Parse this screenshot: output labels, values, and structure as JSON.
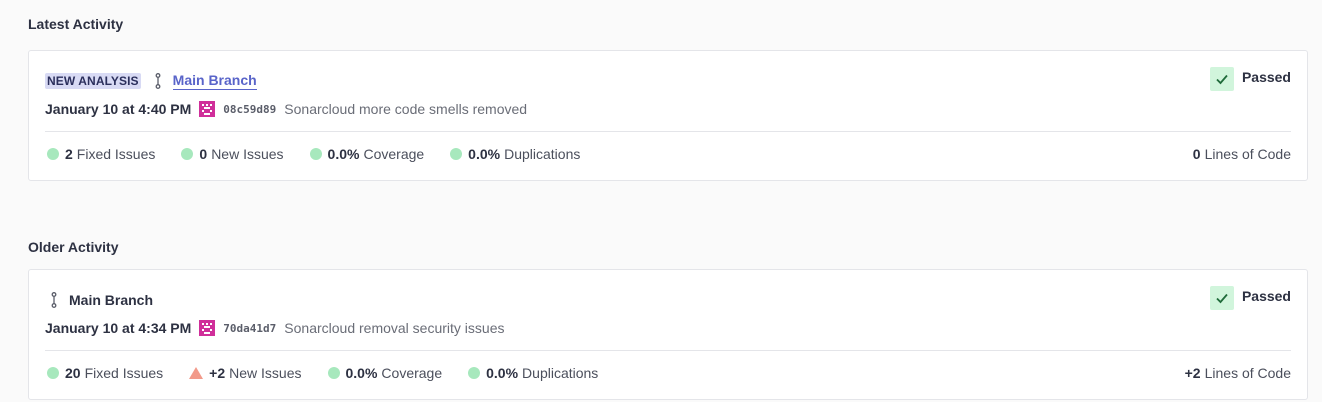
{
  "sections": {
    "latest_title": "Latest Activity",
    "older_title": "Older Activity"
  },
  "latest": {
    "badge": "NEW ANALYSIS",
    "branch": "Main Branch",
    "date": "January 10 at 4:40 PM",
    "hash": "08c59d89",
    "message": "Sonarcloud more code smells removed",
    "status": "Passed",
    "metrics": {
      "fixed_value": "2",
      "fixed_label": "Fixed Issues",
      "new_value": "0",
      "new_label": "New Issues",
      "coverage_value": "0.0%",
      "coverage_label": "Coverage",
      "dup_value": "0.0%",
      "dup_label": "Duplications",
      "loc_value": "0",
      "loc_label": "Lines of Code"
    }
  },
  "older": {
    "branch": "Main Branch",
    "date": "January 10 at 4:34 PM",
    "hash": "70da41d7",
    "message": "Sonarcloud removal security issues",
    "status": "Passed",
    "metrics": {
      "fixed_value": "20",
      "fixed_label": "Fixed Issues",
      "new_value": "+2",
      "new_label": "New Issues",
      "coverage_value": "0.0%",
      "coverage_label": "Coverage",
      "dup_value": "0.0%",
      "dup_label": "Duplications",
      "loc_value": "+2",
      "loc_label": "Lines of Code"
    }
  },
  "colors": {
    "passed_bg": "#d1f5dc",
    "good_dot": "#a7e8bd",
    "bad_triangle": "#f29a8a",
    "link": "#5964c9",
    "commit_icon": "#d02f9a"
  },
  "icons": {
    "branch": "branch-icon",
    "commit": "commit-avatar-icon",
    "check": "check-icon"
  }
}
